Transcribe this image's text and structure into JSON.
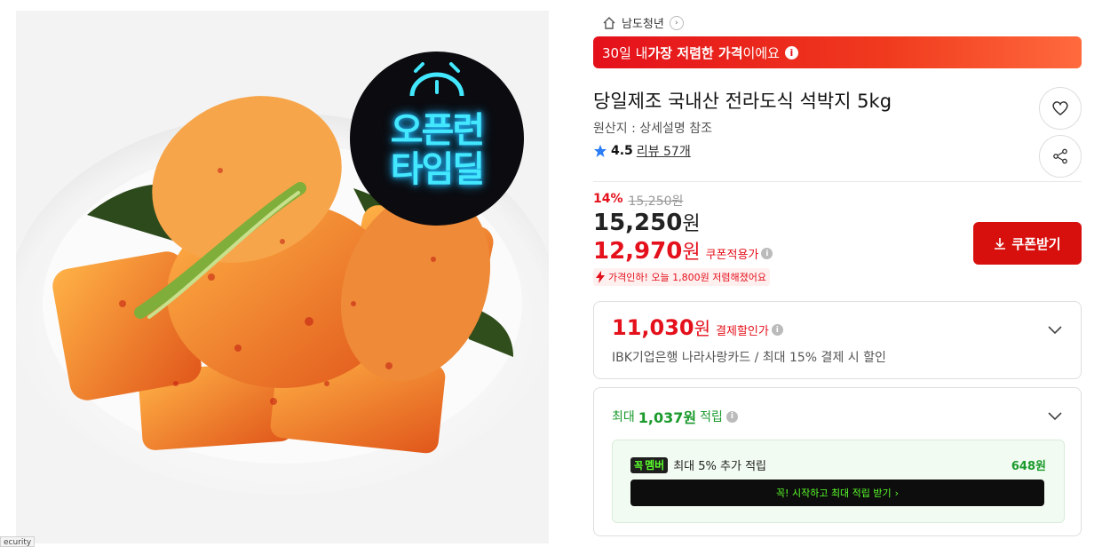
{
  "product_image": {
    "badge_line1": "오픈런",
    "badge_line2": "타임딜",
    "badge_icon": "alarm-clock-icon"
  },
  "security_tag": "ecurity",
  "breadcrumb": {
    "home_icon": "home-icon",
    "seller": "남도청년",
    "chevron": "›"
  },
  "lowest_banner": {
    "prefix": "30일 내 ",
    "highlight": "가장 저렴한 가격",
    "suffix": "이에요",
    "info": "i"
  },
  "product": {
    "title": "당일제조 국내산 전라도식 석박지 5kg",
    "origin": "원산지 : 상세설명 참조",
    "rating": "4.5",
    "reviews": "리뷰 57개"
  },
  "actions": {
    "wishlist_icon": "heart-icon",
    "share_icon": "share-icon"
  },
  "pricing": {
    "discount_rate": "14%",
    "original_price": "15,250원",
    "sale_price": "15,250",
    "sale_unit": "원",
    "coupon_price": "12,970",
    "coupon_unit": "원",
    "coupon_label": "쿠폰적용가",
    "price_drop_note": "가격인하! 오늘 1,800원 저렴해졌어요",
    "coupon_button": "쿠폰받기"
  },
  "payment_discount": {
    "amount": "11,030",
    "unit": "원",
    "label": "결제할인가",
    "description": "IBK기업은행 나라사랑카드 / 최대 15% 결제 시 할인"
  },
  "points": {
    "prefix": "최대 ",
    "amount": "1,037원",
    "suffix": " 적립",
    "member_logo_1": "꼭",
    "member_logo_2": "멤버",
    "member_text": "최대 5% 추가 적립",
    "member_points": "648원",
    "cta": "꼭! 시작하고 최대 적립 받기",
    "cta_arrow": "›"
  },
  "colors": {
    "accent_red": "#e4101b",
    "button_red": "#d7100d",
    "points_green": "#1a9a2c",
    "neon_green": "#5bff2b",
    "neon_blue": "#43e8ff"
  }
}
